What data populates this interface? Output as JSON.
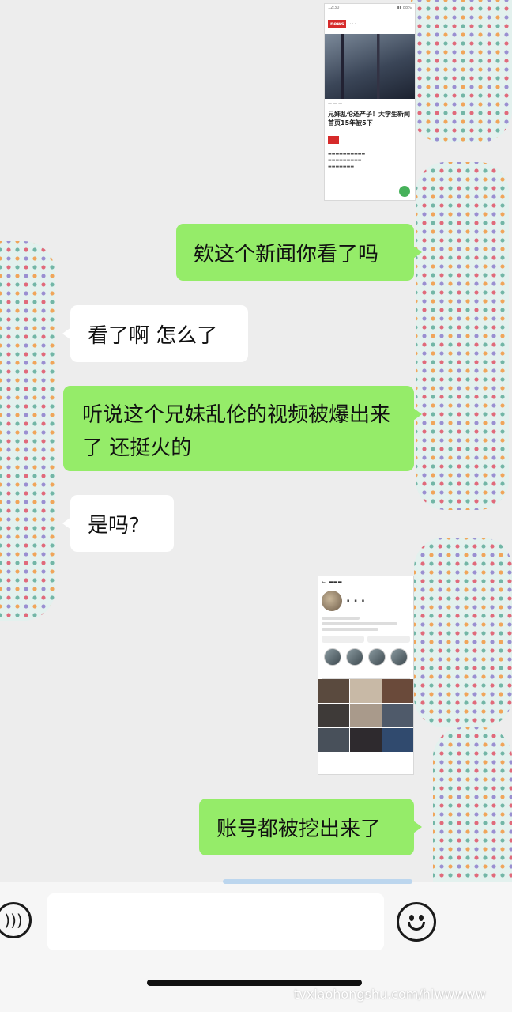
{
  "messages": [
    {
      "sender": "self",
      "type": "image",
      "description": "news-screenshot"
    },
    {
      "sender": "self",
      "type": "text",
      "text": "欸这个新闻你看了吗"
    },
    {
      "sender": "other",
      "type": "text",
      "text": "看了啊 怎么了"
    },
    {
      "sender": "self",
      "type": "text",
      "text": "听说这个兄妹乱伦的视频被爆出来了 还挺火的"
    },
    {
      "sender": "other",
      "type": "text",
      "text": "是吗?"
    },
    {
      "sender": "self",
      "type": "image",
      "description": "profile-screenshot"
    },
    {
      "sender": "self",
      "type": "text",
      "text": "账号都被挖出来了"
    }
  ],
  "news_thumb": {
    "headline": "兄妹乱伦还产子！大学生新闻首页15年被5下"
  },
  "watermark": "tvxiaohongshu.com/hlwwwww",
  "colors": {
    "chat_bg": "#ededed",
    "self_bubble": "#95ec69",
    "other_bubble": "#ffffff",
    "input_bar": "#f6f6f6"
  },
  "icons": [
    "voice-icon",
    "emoji-icon",
    "plus-icon"
  ]
}
